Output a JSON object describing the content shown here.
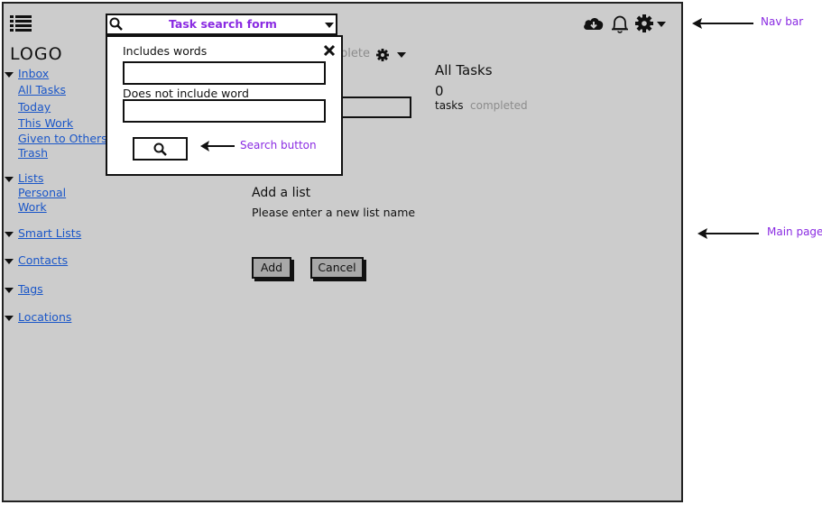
{
  "nav": {
    "search_label": "Task search form",
    "icons": [
      "menu-icon",
      "search-icon",
      "cloud-download-icon",
      "bell-icon",
      "gear-icon",
      "chevron-down-icon"
    ]
  },
  "sidebar": {
    "logo": "LOGO",
    "inbox": {
      "label": "Inbox",
      "items": [
        "All Tasks",
        "Today",
        "This Work",
        "Given to Others",
        "Trash"
      ]
    },
    "lists": {
      "label": "Lists",
      "items": [
        "Personal",
        "Work"
      ]
    },
    "smart_lists": "Smart Lists",
    "contacts": "Contacts",
    "tags": "Tags",
    "locations": "Locations"
  },
  "search_popup": {
    "includes_label": "Includes words",
    "excludes_label": "Does not include word",
    "includes_value": "",
    "excludes_value": ""
  },
  "main": {
    "behind_text": "plete",
    "summary_title": "All Tasks",
    "count": "0",
    "tasks_label": "tasks",
    "completed_label": "completed",
    "add_list_title": "Add a list",
    "add_list_prompt": "Please enter a new list name",
    "add_button": "Add",
    "cancel_button": "Cancel"
  },
  "annotations": {
    "nav_bar": "Nav bar",
    "main_page": "Main page",
    "search_button": "Search button"
  },
  "colors": {
    "background": "#cccccc",
    "link": "#1a56c8",
    "annotation": "#8a2be2"
  }
}
